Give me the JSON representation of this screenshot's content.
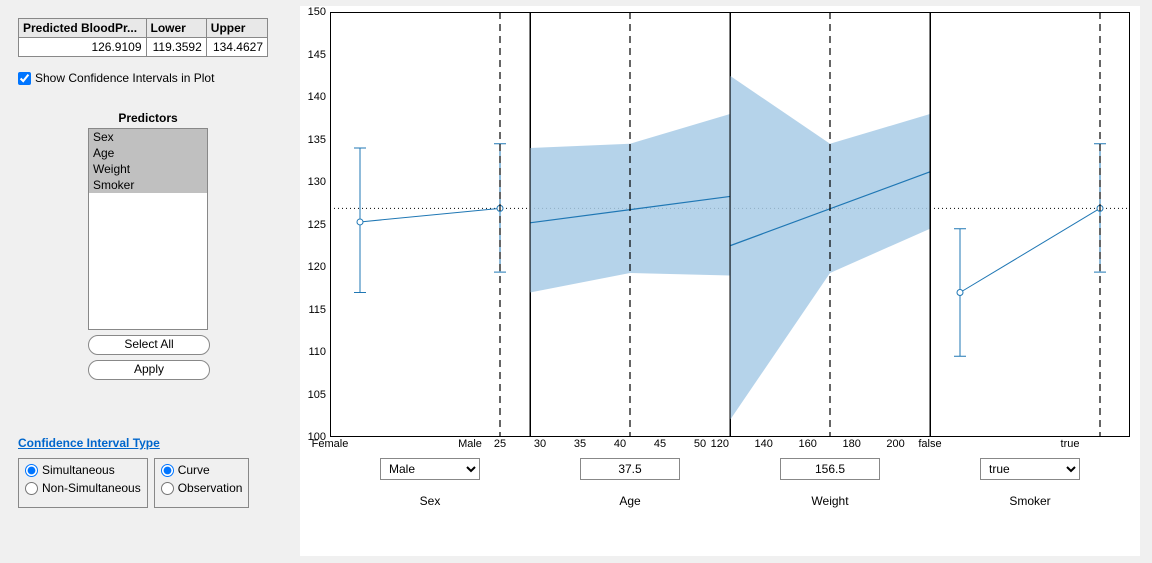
{
  "result_table": {
    "headers": [
      "Predicted BloodPr...",
      "Lower",
      "Upper"
    ],
    "row": [
      "126.9109",
      "119.3592",
      "134.4627"
    ]
  },
  "show_ci_label": "Show Confidence Intervals in Plot",
  "predictors_title": "Predictors",
  "predictors": [
    "Sex",
    "Age",
    "Weight",
    "Smoker"
  ],
  "select_all_label": "Select All",
  "apply_label": "Apply",
  "ci_link_label": "Confidence Interval Type",
  "ci_group1": {
    "opt1": "Simultaneous",
    "opt2": "Non-Simultaneous",
    "selected": "opt1"
  },
  "ci_group2": {
    "opt1": "Curve",
    "opt2": "Observation",
    "selected": "opt1"
  },
  "panels": {
    "sex": {
      "label": "Sex",
      "control": "select",
      "value": "Male",
      "ticks": [
        "Female",
        "Male"
      ]
    },
    "age": {
      "label": "Age",
      "control": "input",
      "value": "37.5",
      "ticks": [
        "25",
        "30",
        "35",
        "40",
        "45",
        "50"
      ]
    },
    "weight": {
      "label": "Weight",
      "control": "input",
      "value": "156.5",
      "ticks": [
        "120",
        "140",
        "160",
        "180",
        "200"
      ]
    },
    "smoker": {
      "label": "Smoker",
      "control": "select",
      "value": "true",
      "ticks": [
        "false",
        "true"
      ]
    }
  },
  "y_ticks": [
    "100",
    "105",
    "110",
    "115",
    "120",
    "125",
    "130",
    "135",
    "140",
    "145",
    "150"
  ],
  "chart_data": {
    "type": "conditional-effects",
    "ylim": [
      100,
      150
    ],
    "reference_line": 126.9,
    "panels": [
      {
        "predictor": "Sex",
        "type": "categorical",
        "categories": [
          "Female",
          "Male"
        ],
        "current": "Male",
        "points": [
          {
            "cat": "Female",
            "mean": 125.3,
            "low": 117.0,
            "high": 134.0
          },
          {
            "cat": "Male",
            "mean": 126.9,
            "low": 119.4,
            "high": 134.5
          }
        ]
      },
      {
        "predictor": "Age",
        "type": "continuous",
        "xlim": [
          25,
          50
        ],
        "current": 37.5,
        "line": [
          {
            "x": 25,
            "y": 125.2
          },
          {
            "x": 50,
            "y": 128.3
          }
        ],
        "band": [
          {
            "x": 25,
            "low": 117.0,
            "high": 134.0
          },
          {
            "x": 37.5,
            "low": 119.3,
            "high": 134.5
          },
          {
            "x": 50,
            "low": 119.0,
            "high": 138.0
          }
        ]
      },
      {
        "predictor": "Weight",
        "type": "continuous",
        "xlim": [
          111,
          202
        ],
        "current": 156.5,
        "line": [
          {
            "x": 111,
            "y": 122.5
          },
          {
            "x": 202,
            "y": 131.2
          }
        ],
        "band": [
          {
            "x": 111,
            "low": 102.0,
            "high": 142.5
          },
          {
            "x": 156.5,
            "low": 119.3,
            "high": 134.5
          },
          {
            "x": 202,
            "low": 124.5,
            "high": 138.0
          }
        ]
      },
      {
        "predictor": "Smoker",
        "type": "categorical",
        "categories": [
          "false",
          "true"
        ],
        "current": "true",
        "points": [
          {
            "cat": "false",
            "mean": 117.0,
            "low": 109.5,
            "high": 124.5
          },
          {
            "cat": "true",
            "mean": 126.9,
            "low": 119.4,
            "high": 134.5
          }
        ]
      }
    ]
  }
}
